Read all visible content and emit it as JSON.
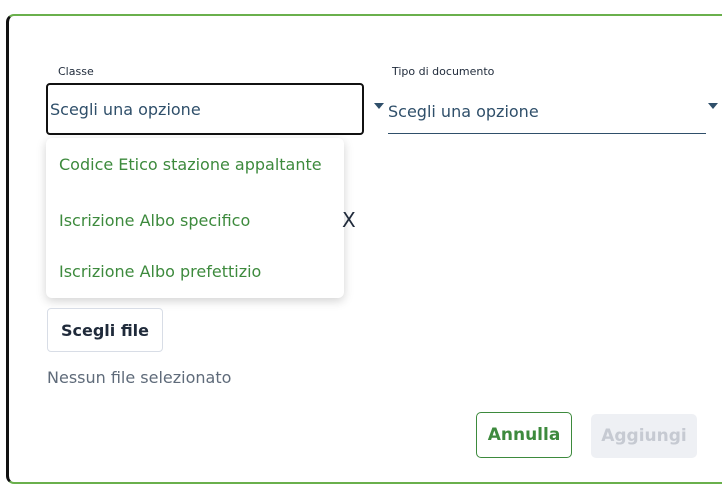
{
  "form": {
    "classe_label": "Classe",
    "classe_placeholder": "Scegli una opzione",
    "tipo_label": "Tipo di documento",
    "tipo_placeholder": "Scegli una opzione"
  },
  "dropdown": {
    "options": [
      "Codice Etico stazione appaltante",
      "Iscrizione Albo specifico",
      "Iscrizione Albo prefettizio"
    ]
  },
  "file": {
    "button_label": "Scegli file",
    "status": "Nessun file selezionato",
    "remove_glyph": "X"
  },
  "actions": {
    "cancel_label": "Annulla",
    "add_label": "Aggiungi"
  },
  "colors": {
    "accent_green": "#3d8a3d",
    "dialog_border": "#6ab04c",
    "disabled_bg": "#eef0f4"
  }
}
